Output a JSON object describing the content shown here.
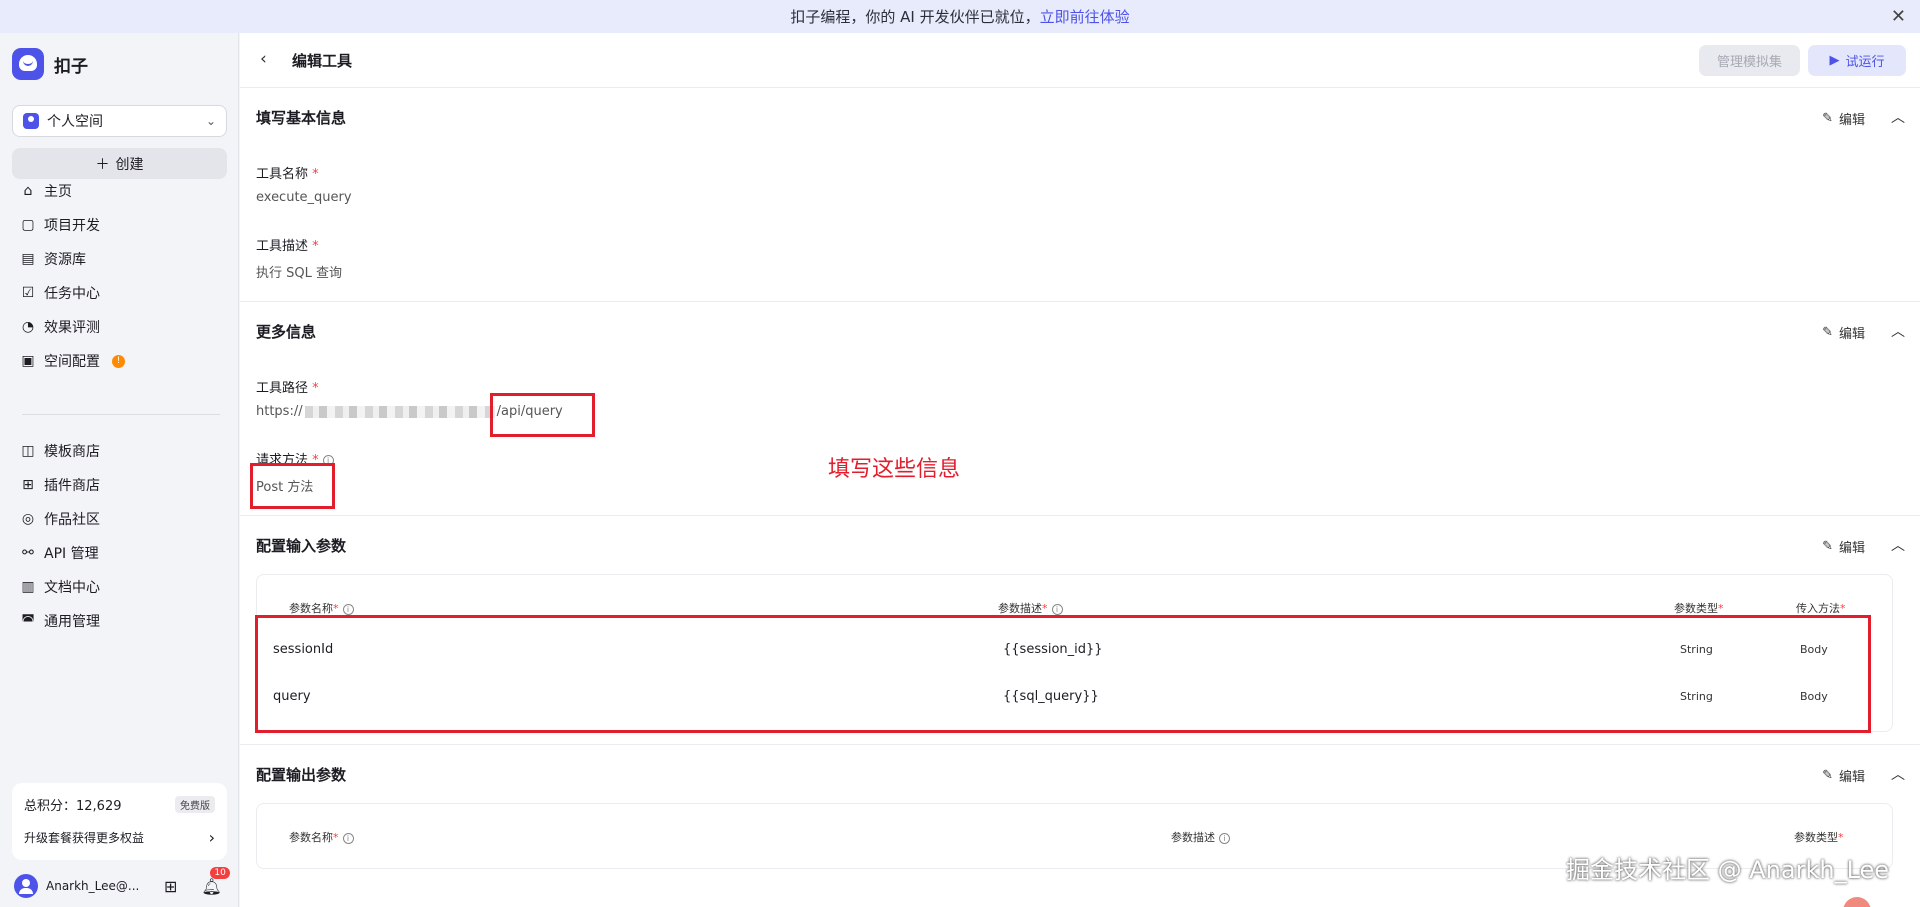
{
  "banner": {
    "text": "扣子编程，你的 AI 开发伙伴已就位，",
    "link": "立即前往体验",
    "close": "✕"
  },
  "sidebar": {
    "brand": "扣子",
    "space": "个人空间",
    "create": "创建",
    "nav_main": [
      {
        "label": "主页",
        "icon": "⌂"
      },
      {
        "label": "项目开发",
        "icon": "▢"
      },
      {
        "label": "资源库",
        "icon": "▤"
      },
      {
        "label": "任务中心",
        "icon": "☑"
      },
      {
        "label": "效果评测",
        "icon": "◔"
      },
      {
        "label": "空间配置",
        "icon": "▣",
        "badge": "!"
      }
    ],
    "nav_secondary": [
      {
        "label": "模板商店",
        "icon": "◫"
      },
      {
        "label": "插件商店",
        "icon": "⊞"
      },
      {
        "label": "作品社区",
        "icon": "◎"
      },
      {
        "label": "API 管理",
        "icon": "⚯"
      },
      {
        "label": "文档中心",
        "icon": "▥"
      },
      {
        "label": "通用管理",
        "icon": "◚"
      }
    ],
    "points": {
      "label": "总积分：12,629",
      "plan": "免费版",
      "upgrade": "升级套餐获得更多权益"
    },
    "user": {
      "name": "Anarkh_Lee@...",
      "notifications": "10"
    }
  },
  "header": {
    "title": "编辑工具",
    "mock_btn": "管理模拟集",
    "run_btn": "试运行"
  },
  "edit_label": "编辑",
  "basic": {
    "title": "填写基本信息",
    "name_label": "工具名称",
    "name_value": "execute_query",
    "desc_label": "工具描述",
    "desc_value": "执行 SQL 查询"
  },
  "more": {
    "title": "更多信息",
    "path_label": "工具路径",
    "path_prefix": "https://",
    "path_suffix": "/api/query",
    "method_label": "请求方法",
    "method_value": "Post 方法"
  },
  "input_params": {
    "title": "配置输入参数",
    "headers": {
      "name": "参数名称",
      "desc": "参数描述",
      "type": "参数类型",
      "method": "传入方法"
    },
    "rows": [
      {
        "name": "sessionId",
        "desc": "{{session_id}}",
        "type": "String",
        "method": "Body"
      },
      {
        "name": "query",
        "desc": "{{sql_query}}",
        "type": "String",
        "method": "Body"
      }
    ]
  },
  "output_params": {
    "title": "配置输出参数",
    "headers": {
      "name": "参数名称",
      "desc": "参数描述",
      "type": "参数类型"
    }
  },
  "annotation": "填写这些信息",
  "watermark": "掘金技术社区 @ Anarkh_Lee"
}
